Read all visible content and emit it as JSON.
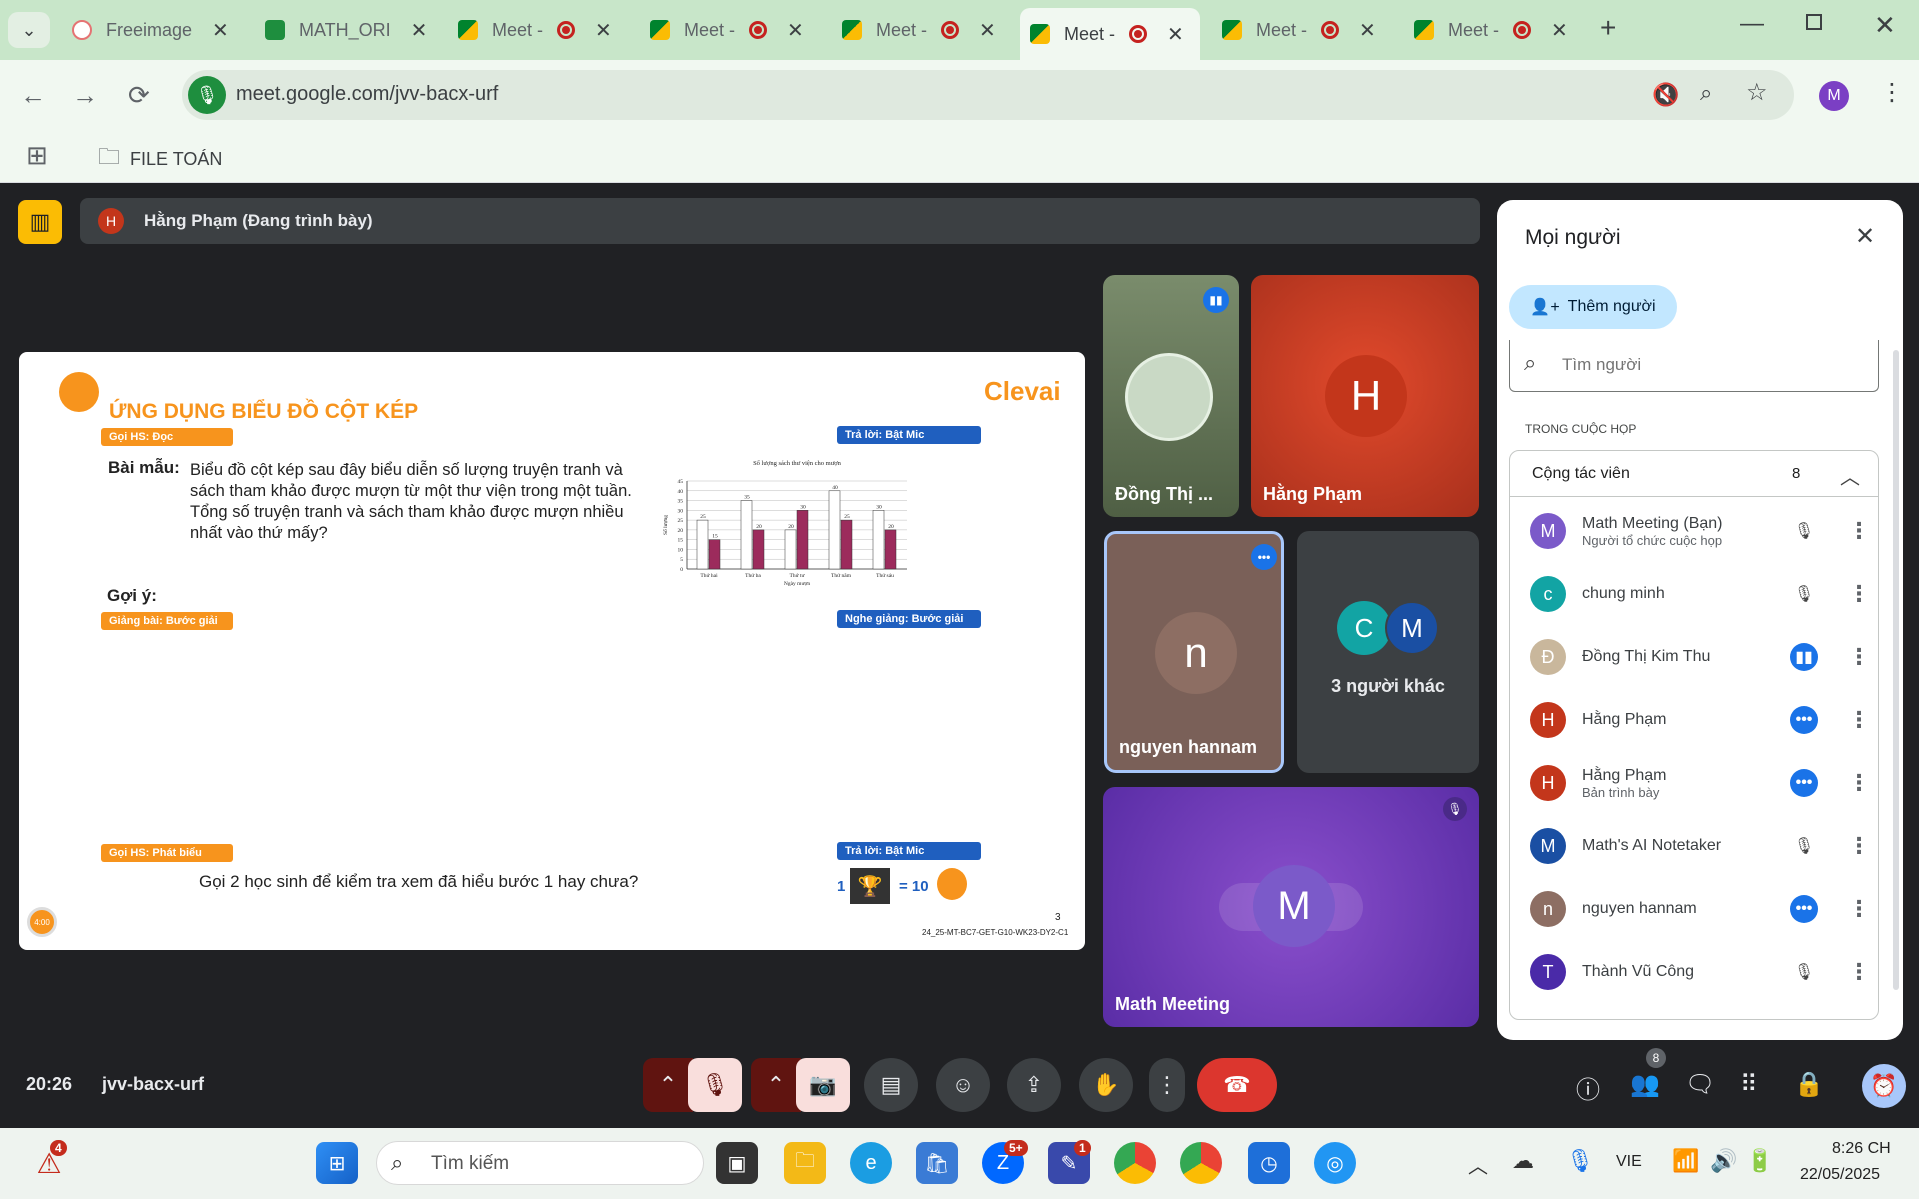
{
  "tabs": [
    {
      "label": "Freeimage",
      "active": false
    },
    {
      "label": "MATH_ORI",
      "active": false
    },
    {
      "label": "Meet -",
      "active": false
    },
    {
      "label": "Meet -",
      "active": false
    },
    {
      "label": "Meet -",
      "active": false
    },
    {
      "label": "Meet -",
      "active": true
    },
    {
      "label": "Meet -",
      "active": false
    },
    {
      "label": "Meet -",
      "active": false
    }
  ],
  "address": {
    "url": "meet.google.com/jvv-bacx-urf",
    "profile_initial": "M"
  },
  "bookmarks": {
    "folder": "FILE TOÁN"
  },
  "presenter_bar": {
    "initial": "H",
    "text": "Hằng Phạm (Đang trình bày)"
  },
  "slide": {
    "brand": "Clevai",
    "title": "ỨNG DỤNG BIỂU ĐỒ CỘT KÉP",
    "tag_goi_hs_doc": "Gọi HS: Đọc",
    "tag_tra_loi_1": "Trả lời: Bật Mic",
    "bai_mau_label": "Bài mẫu:",
    "bai_mau_text": "Biểu đồ cột kép sau đây biểu diễn số lượng truyện tranh và sách tham khảo được mượn từ một thư viện trong một tuần. Tổng số truyện tranh và sách tham khảo được mượn nhiều nhất vào thứ mấy?",
    "goi_y": "Gợi ý:",
    "tag_giang_bai": "Giảng bài: Bước giải",
    "tag_nghe_giang": "Nghe giảng: Bước giải",
    "tag_goi_hs_phat_bieu": "Gọi HS: Phát biểu",
    "tag_tra_loi_2": "Trả lời: Bật Mic",
    "question": "Gọi 2 học sinh để kiểm tra xem đã hiểu bước 1 hay chưa?",
    "reward_count": "1",
    "reward_eq": "= 10",
    "page_number": "3",
    "code": "24_25-MT-BC7-GET-G10-WK23-DY2-C1",
    "timer": "4:00"
  },
  "chart_data": {
    "type": "bar",
    "title": "Số lượng sách thư viện cho mượn",
    "ylabel": "Số lượng",
    "xlabel": "Ngày mượn",
    "categories": [
      "Thứ hai",
      "Thứ ba",
      "Thứ tư",
      "Thứ năm",
      "Thứ sáu"
    ],
    "series": [
      {
        "name": "Truyện tranh",
        "values": [
          25,
          35,
          20,
          40,
          30
        ],
        "color": "#ffffff"
      },
      {
        "name": "Sách tham khảo",
        "values": [
          15,
          20,
          30,
          25,
          20
        ],
        "color": "#9c2b5c"
      }
    ],
    "ylim": [
      0,
      45
    ],
    "yticks": [
      0,
      5,
      10,
      15,
      20,
      25,
      30,
      35,
      40,
      45
    ]
  },
  "tiles": {
    "dong": {
      "name": "Đồng Thị ..."
    },
    "hang": {
      "name": "Hằng Phạm",
      "initial": "H"
    },
    "nguyen": {
      "name": "nguyen hannam",
      "initial": "n"
    },
    "others": {
      "label": "3 người khác",
      "initials": [
        "C",
        "M"
      ]
    },
    "math": {
      "name": "Math Meeting",
      "initial": "M"
    }
  },
  "panel": {
    "title": "Mọi người",
    "add_button": "Thêm người",
    "search_placeholder": "Tìm người",
    "section": "TRONG CUỘC HỌP",
    "group_label": "Cộng tác viên",
    "group_count": "8",
    "people": [
      {
        "initial": "M",
        "name": "Math Meeting (Bạn)",
        "sub": "Người tổ chức cuộc họp",
        "color": "#7b5ac9",
        "state": "muted"
      },
      {
        "initial": "c",
        "name": "chung minh",
        "sub": "",
        "color": "#12a4a4",
        "state": "muted"
      },
      {
        "initial": "Đ",
        "name": "Đồng Thị Kim Thu",
        "sub": "",
        "color": "#c9b79c",
        "state": "speaking"
      },
      {
        "initial": "H",
        "name": "Hằng Phạm",
        "sub": "",
        "color": "#c3361b",
        "state": "more"
      },
      {
        "initial": "H",
        "name": "Hằng Phạm",
        "sub": "Bản trình bày",
        "color": "#c3361b",
        "state": "more"
      },
      {
        "initial": "M",
        "name": "Math's AI Notetaker",
        "sub": "",
        "color": "#1a4fa3",
        "state": "muted"
      },
      {
        "initial": "n",
        "name": "nguyen hannam",
        "sub": "",
        "color": "#8d6e63",
        "state": "more"
      },
      {
        "initial": "T",
        "name": "Thành Vũ Công",
        "sub": "",
        "color": "#4a2aa8",
        "state": "muted"
      }
    ]
  },
  "meeting": {
    "time": "20:26",
    "code": "jvv-bacx-urf",
    "people_badge": "8"
  },
  "taskbar": {
    "search": "Tìm kiếm",
    "lang": "VIE",
    "clock": "8:26 CH",
    "date": "22/05/2025",
    "alert_badge": "4",
    "zalo_badge": "5+",
    "app_badge": "1"
  }
}
